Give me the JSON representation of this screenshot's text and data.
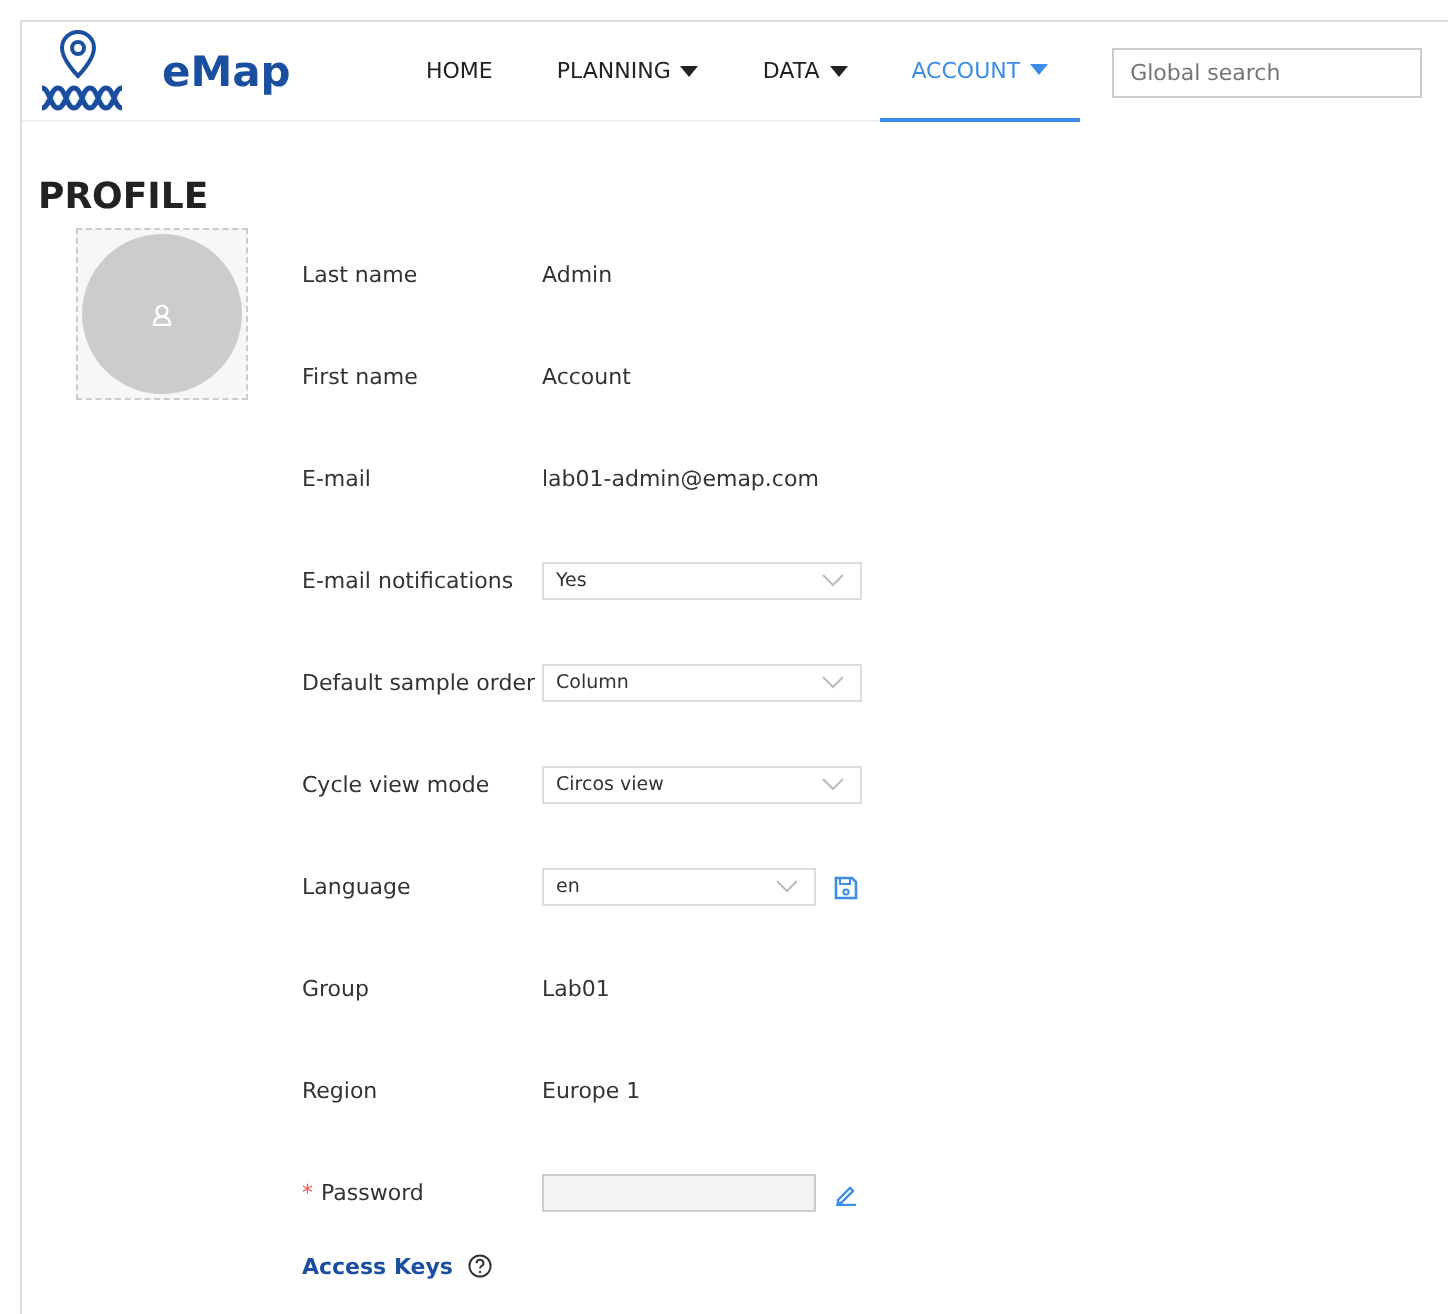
{
  "app": {
    "name": "eMap"
  },
  "nav": [
    {
      "label": "HOME",
      "dropdown": false,
      "selected": false
    },
    {
      "label": "PLANNING",
      "dropdown": true,
      "selected": false
    },
    {
      "label": "DATA",
      "dropdown": true,
      "selected": false
    },
    {
      "label": "ACCOUNT",
      "dropdown": true,
      "selected": true
    }
  ],
  "search": {
    "placeholder": "Global search"
  },
  "page_title": "PROFILE",
  "fields": [
    {
      "label": "Last name",
      "kind": "text",
      "value": "Admin"
    },
    {
      "label": "First name",
      "kind": "text",
      "value": "Account"
    },
    {
      "label": "E-mail",
      "kind": "text",
      "value": "lab01-admin@emap.com"
    },
    {
      "label": "E-mail notifications",
      "kind": "select",
      "value": "Yes"
    },
    {
      "label": "Default sample order",
      "kind": "select",
      "value": "Column"
    },
    {
      "label": "Cycle view mode",
      "kind": "select",
      "value": "Circos view"
    },
    {
      "label": "Language",
      "kind": "select",
      "value": "en",
      "save": true
    },
    {
      "label": "Group",
      "kind": "text",
      "value": "Lab01"
    },
    {
      "label": "Region",
      "kind": "text",
      "value": "Europe 1"
    },
    {
      "label": "Password",
      "kind": "password",
      "required_mark": "*",
      "edit": true
    }
  ],
  "access_keys": {
    "title": "Access Keys"
  }
}
